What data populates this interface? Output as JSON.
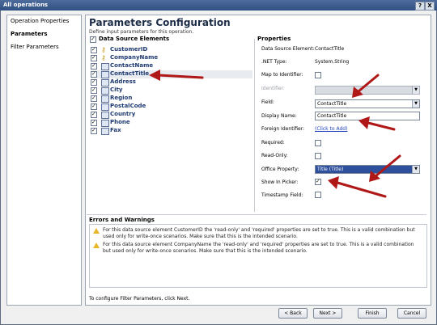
{
  "window": {
    "title": "All operations",
    "help_btn": "?",
    "close_btn": "X"
  },
  "nav": {
    "items": [
      {
        "label": "Operation Properties",
        "active": false
      },
      {
        "label": "Parameters",
        "active": true
      },
      {
        "label": "Filter Parameters",
        "active": false
      }
    ]
  },
  "main": {
    "title": "Parameters Configuration",
    "subtitle": "Define input parameters for this operation.",
    "elements_header": "Data Source Elements",
    "properties_header": "Properties"
  },
  "elements": [
    {
      "label": "CustomerID",
      "icon": "key-icon",
      "checked": true
    },
    {
      "label": "CompanyName",
      "icon": "key-icon",
      "checked": true
    },
    {
      "label": "ContactName",
      "icon": "field-icon",
      "checked": true
    },
    {
      "label": "ContactTitle",
      "icon": "field-icon",
      "checked": true,
      "selected": true
    },
    {
      "label": "Address",
      "icon": "field-icon",
      "checked": true
    },
    {
      "label": "City",
      "icon": "field-icon",
      "checked": true
    },
    {
      "label": "Region",
      "icon": "field-icon",
      "checked": true
    },
    {
      "label": "PostalCode",
      "icon": "field-icon",
      "checked": true
    },
    {
      "label": "Country",
      "icon": "field-icon",
      "checked": true
    },
    {
      "label": "Phone",
      "icon": "field-icon",
      "checked": true
    },
    {
      "label": "Fax",
      "icon": "field-icon",
      "checked": true
    }
  ],
  "properties": {
    "data_source_element": {
      "label": "Data Source Element:",
      "value": "ContactTitle"
    },
    "net_type": {
      "label": ".NET Type:",
      "value": "System.String"
    },
    "map_to_identifier": {
      "label": "Map to Identifier:",
      "checked": false
    },
    "identifier": {
      "label": "Identifier:",
      "value": ""
    },
    "field": {
      "label": "Field:",
      "value": "ContactTitle"
    },
    "display_name": {
      "label": "Display Name:",
      "value": "ContactTitle"
    },
    "foreign_identifier": {
      "label": "Foreign Identifier:",
      "value": "(Click to Add)"
    },
    "required": {
      "label": "Required:",
      "checked": false
    },
    "read_only": {
      "label": "Read-Only:",
      "checked": false
    },
    "office_property": {
      "label": "Office Property:",
      "value": "Title (Title)"
    },
    "show_in_picker": {
      "label": "Show In Picker:",
      "checked": true
    },
    "timestamp_field": {
      "label": "Timestamp Field:",
      "checked": false
    }
  },
  "errors": {
    "header": "Errors and Warnings",
    "items": [
      "For this data source element CustomerID the 'read-only' and 'required' properties are set to true. This is a valid combination but used only for write-once scenarios. Make sure that this is the intended scenario.",
      "For this data source element CompanyName the 'read-only' and 'required' properties are set to true. This is a valid combination but used only for write-once scenarios. Make sure that this is the intended scenario."
    ]
  },
  "footer": {
    "hint": "To configure Filter Parameters, click Next."
  },
  "buttons": {
    "back": "< Back",
    "next": "Next >",
    "finish": "Finish",
    "cancel": "Cancel"
  },
  "colors": {
    "annotation_arrow": "#b01818",
    "title_bar": "#3a5a8e"
  }
}
